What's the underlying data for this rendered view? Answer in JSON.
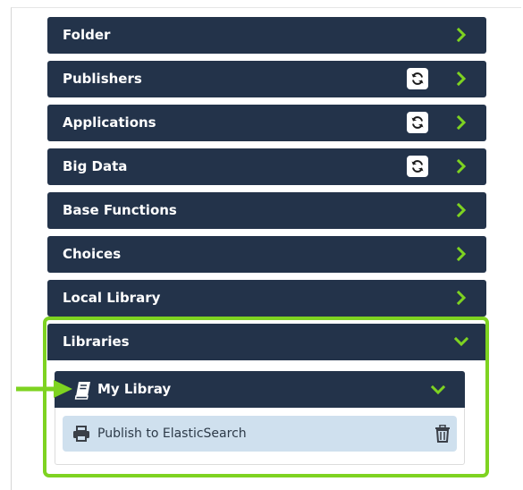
{
  "accordion": {
    "items": [
      {
        "label": "Folder",
        "refresh": false
      },
      {
        "label": "Publishers",
        "refresh": true
      },
      {
        "label": "Applications",
        "refresh": true
      },
      {
        "label": "Big Data",
        "refresh": true
      },
      {
        "label": "Base Functions",
        "refresh": false
      },
      {
        "label": "Choices",
        "refresh": false
      },
      {
        "label": "Local Library",
        "refresh": false
      },
      {
        "label": "Libraries",
        "refresh": false,
        "expanded": true
      }
    ]
  },
  "libraries": {
    "my_library": {
      "label": "My Libray",
      "items": [
        {
          "label": "Publish to ElasticSearch"
        }
      ]
    }
  },
  "colors": {
    "header_bg": "#23334a",
    "accent_green": "#7ed321",
    "item_bg": "#cfe0ee"
  },
  "icons": {
    "expand": "chevron-right-icon",
    "collapse": "chevron-down-icon",
    "refresh": "refresh-icon",
    "book": "book-icon",
    "printer": "printer-icon",
    "delete": "trash-icon",
    "pointer": "arrow-annotation"
  }
}
